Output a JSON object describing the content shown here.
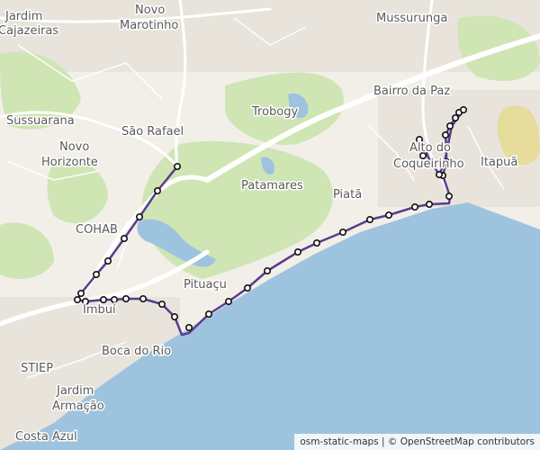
{
  "map": {
    "style": "OpenStreetMap tiles",
    "colors": {
      "land": "#f2efe9",
      "water": "#9ec3df",
      "park": "#cfe5b4",
      "route": "#5b3c8c",
      "marker_stroke": "#111111",
      "marker_fill": "#ffffff",
      "major_road": "#ffffff"
    }
  },
  "places": [
    {
      "id": "jardim-cajazeiras-1",
      "text": "Jardim"
    },
    {
      "id": "jardim-cajazeiras-2",
      "text": "Cajazeiras"
    },
    {
      "id": "novo-marotinho-1",
      "text": "Novo"
    },
    {
      "id": "novo-marotinho-2",
      "text": "Marotinho"
    },
    {
      "id": "mussurunga",
      "text": "Mussurunga"
    },
    {
      "id": "sussuarana",
      "text": "Sussuarana"
    },
    {
      "id": "sao-rafael",
      "text": "São Rafael"
    },
    {
      "id": "trobogy",
      "text": "Trobogy"
    },
    {
      "id": "bairro-da-paz",
      "text": "Bairro da Paz"
    },
    {
      "id": "novo-horizonte-1",
      "text": "Novo"
    },
    {
      "id": "novo-horizonte-2",
      "text": "Horizonte"
    },
    {
      "id": "alto-do-coqueirinho-1",
      "text": "Alto do"
    },
    {
      "id": "alto-do-coqueirinho-2",
      "text": "Coqueirinho"
    },
    {
      "id": "itapua",
      "text": "Itapuã"
    },
    {
      "id": "patamares",
      "text": "Patamares"
    },
    {
      "id": "piata",
      "text": "Piatã"
    },
    {
      "id": "cohab",
      "text": "COHAB"
    },
    {
      "id": "pituacu",
      "text": "Pituaçu"
    },
    {
      "id": "imbui",
      "text": "Imbuí"
    },
    {
      "id": "boca-do-rio",
      "text": "Boca do Rio"
    },
    {
      "id": "stiep",
      "text": "STIEP"
    },
    {
      "id": "jardim-armacao-1",
      "text": "Jardim"
    },
    {
      "id": "jardim-armacao-2",
      "text": "Armação"
    },
    {
      "id": "costa-azul",
      "text": "Costa Azul"
    }
  ],
  "route": {
    "stop_count": 40
  },
  "attribution": "osm-static-maps | © OpenStreetMap contributors"
}
